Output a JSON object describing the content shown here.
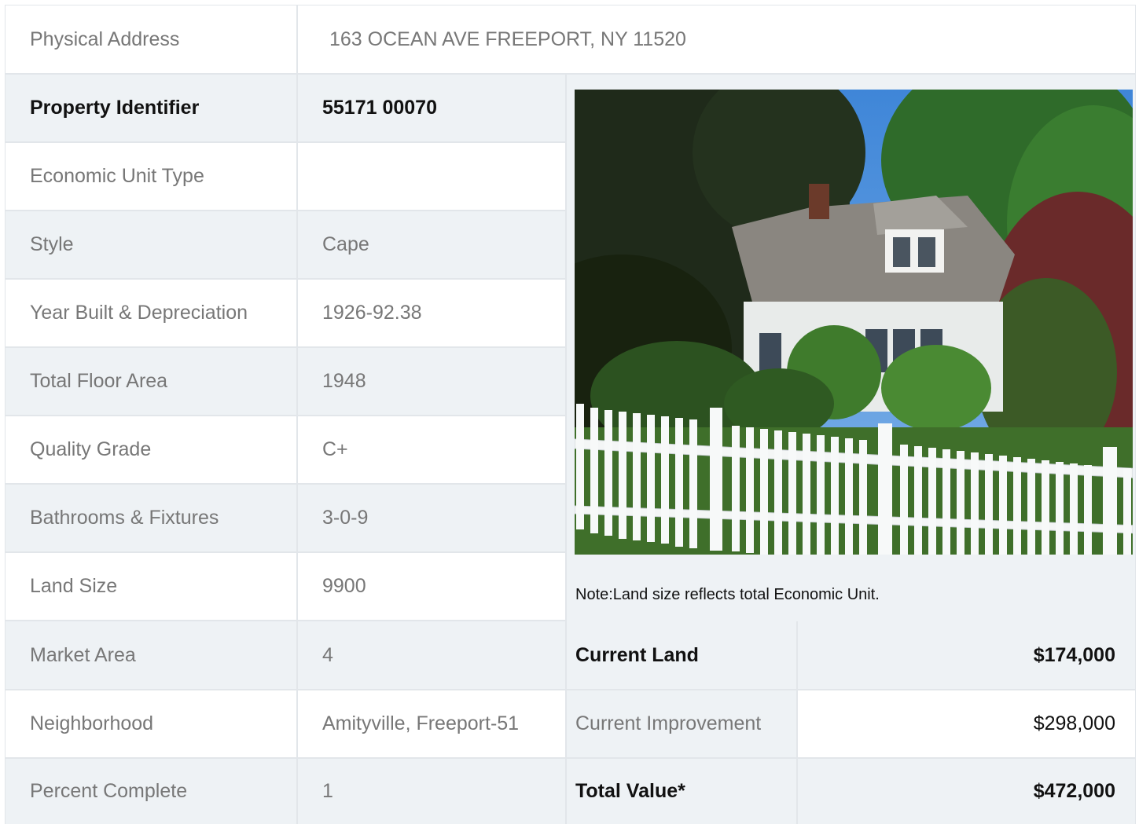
{
  "address": {
    "label": "Physical Address",
    "value": "163  OCEAN AVE  FREEPORT, NY  11520"
  },
  "rows": [
    {
      "label": "Property Identifier",
      "value": "55171  00070"
    },
    {
      "label": "Economic Unit Type",
      "value": ""
    },
    {
      "label": "Style",
      "value": "Cape"
    },
    {
      "label": "Year Built & Depreciation",
      "value": "1926-92.38"
    },
    {
      "label": "Total Floor Area",
      "value": "1948"
    },
    {
      "label": "Quality Grade",
      "value": "C+"
    },
    {
      "label": "Bathrooms & Fixtures",
      "value": "3-0-9"
    },
    {
      "label": "Land Size",
      "value": "9900"
    },
    {
      "label": "Market Area",
      "value": "4"
    },
    {
      "label": "Neighborhood",
      "value": "Amityville, Freeport-51"
    },
    {
      "label": "Percent Complete",
      "value": "1"
    }
  ],
  "note": "Note:Land size reflects total Economic Unit.",
  "values": [
    {
      "label": "Current Land",
      "value": "$174,000"
    },
    {
      "label": "Current Improvement",
      "value": "$298,000"
    },
    {
      "label": "Total Value*",
      "value": "$472,000"
    }
  ]
}
